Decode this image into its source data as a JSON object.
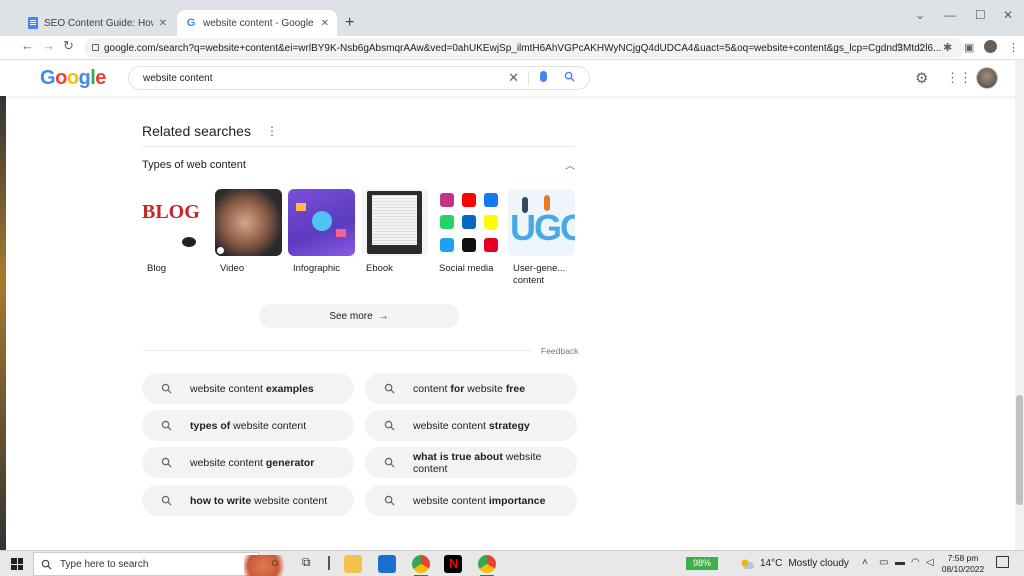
{
  "browser": {
    "tabs": [
      {
        "title": "SEO Content Guide: How to crea",
        "active": false
      },
      {
        "title": "website content - Google Search",
        "active": true
      }
    ],
    "new_tab_glyph": "+",
    "url": "google.com/search?q=website+content&ei=wrlBY9K-Nsb6gAbsmqrAAw&ved=0ahUKEwjSp_ilmtH6AhVGPcAKHWyNCjgQ4dUDCA4&uact=5&oq=website+content&gs_lcp=Cgdnd3Mtd2l6..."
  },
  "google": {
    "logo": [
      "G",
      "o",
      "o",
      "g",
      "l",
      "e"
    ],
    "logo_colors": [
      "#4285f4",
      "#ea4335",
      "#fbbc05",
      "#4285f4",
      "#34a853",
      "#ea4335"
    ],
    "query": "website content"
  },
  "related": {
    "title": "Related searches",
    "types_title": "Types of web content",
    "cards": [
      {
        "label": "Blog"
      },
      {
        "label": "Video"
      },
      {
        "label": "Infographic"
      },
      {
        "label": "Ebook"
      },
      {
        "label": "Social media"
      },
      {
        "label": "User-gene... content"
      }
    ],
    "see_more": "See more",
    "feedback": "Feedback",
    "chips": [
      {
        "pre": "website content ",
        "bold": "examples",
        "post": ""
      },
      {
        "pre": "content ",
        "bold": "for",
        "post": " website ",
        "bold2": "free"
      },
      {
        "pre": "",
        "bold": "types of",
        "post": " website content"
      },
      {
        "pre": "website content ",
        "bold": "strategy",
        "post": ""
      },
      {
        "pre": "website content ",
        "bold": "generator",
        "post": ""
      },
      {
        "pre": "",
        "bold": "what is true about",
        "post": " website content"
      },
      {
        "pre": "",
        "bold": "how to write",
        "post": " website content"
      },
      {
        "pre": "website content ",
        "bold": "importance",
        "post": ""
      }
    ]
  },
  "taskbar": {
    "search_placeholder": "Type here to search",
    "battery": "98%",
    "temperature": "14°C",
    "weather": "Mostly cloudy",
    "time": "7:58 pm",
    "date": "08/10/2022"
  },
  "colors": {
    "accent": "#1a73e8",
    "chip_bg": "#f1f3f4"
  }
}
